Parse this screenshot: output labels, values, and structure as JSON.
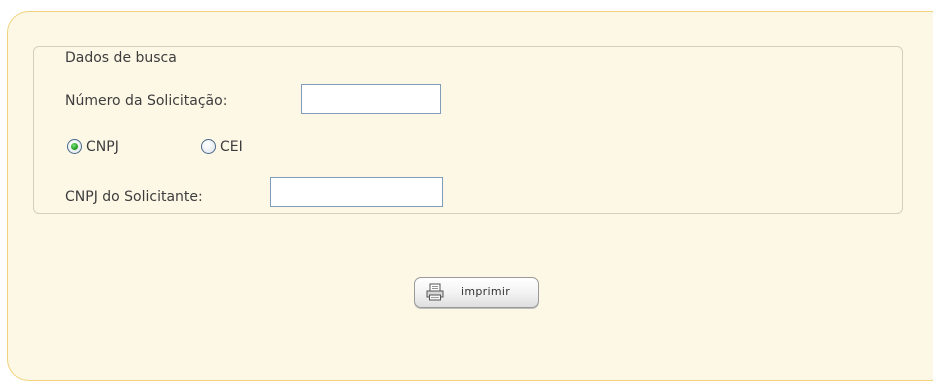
{
  "form": {
    "legend": "Dados de busca",
    "request_number_label": "Número da Solicitação:",
    "request_number_value": "",
    "document_type": {
      "options": [
        "CNPJ",
        "CEI"
      ],
      "selected": "CNPJ"
    },
    "requester_cnpj_label": "CNPJ do Solicitante:",
    "requester_cnpj_value": ""
  },
  "actions": {
    "print_label": "imprimir",
    "print_icon": "printer-icon"
  },
  "colors": {
    "panel_background": "#fdf8e6",
    "panel_border": "#f1d27a",
    "radio_selected": "#21a121"
  }
}
